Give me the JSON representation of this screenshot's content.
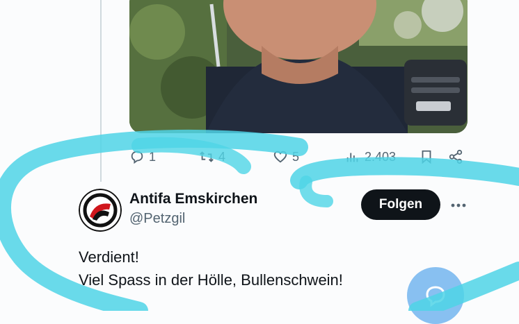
{
  "post": {
    "media_description_icon": "photo",
    "actions": {
      "replies": "1",
      "reposts": "4",
      "likes": "5",
      "views": "2.403",
      "icons": [
        "reply-icon",
        "repost-icon",
        "like-icon",
        "views-icon",
        "bookmark-icon",
        "share-icon"
      ]
    }
  },
  "reply": {
    "author_name": "Antifa Emskirchen",
    "author_handle": "@Petzgil",
    "follow_label": "Folgen",
    "more_icon": "more-icon",
    "text_lines": [
      "Verdient!",
      "Viel Spass in der Hölle, Bullenschwein!"
    ]
  },
  "compose_icon": "compose-icon",
  "colors": {
    "text_secondary": "#536471",
    "button_dark": "#0f1419",
    "scribble": "#4fd4e6",
    "fab": "#7fbbf0"
  }
}
